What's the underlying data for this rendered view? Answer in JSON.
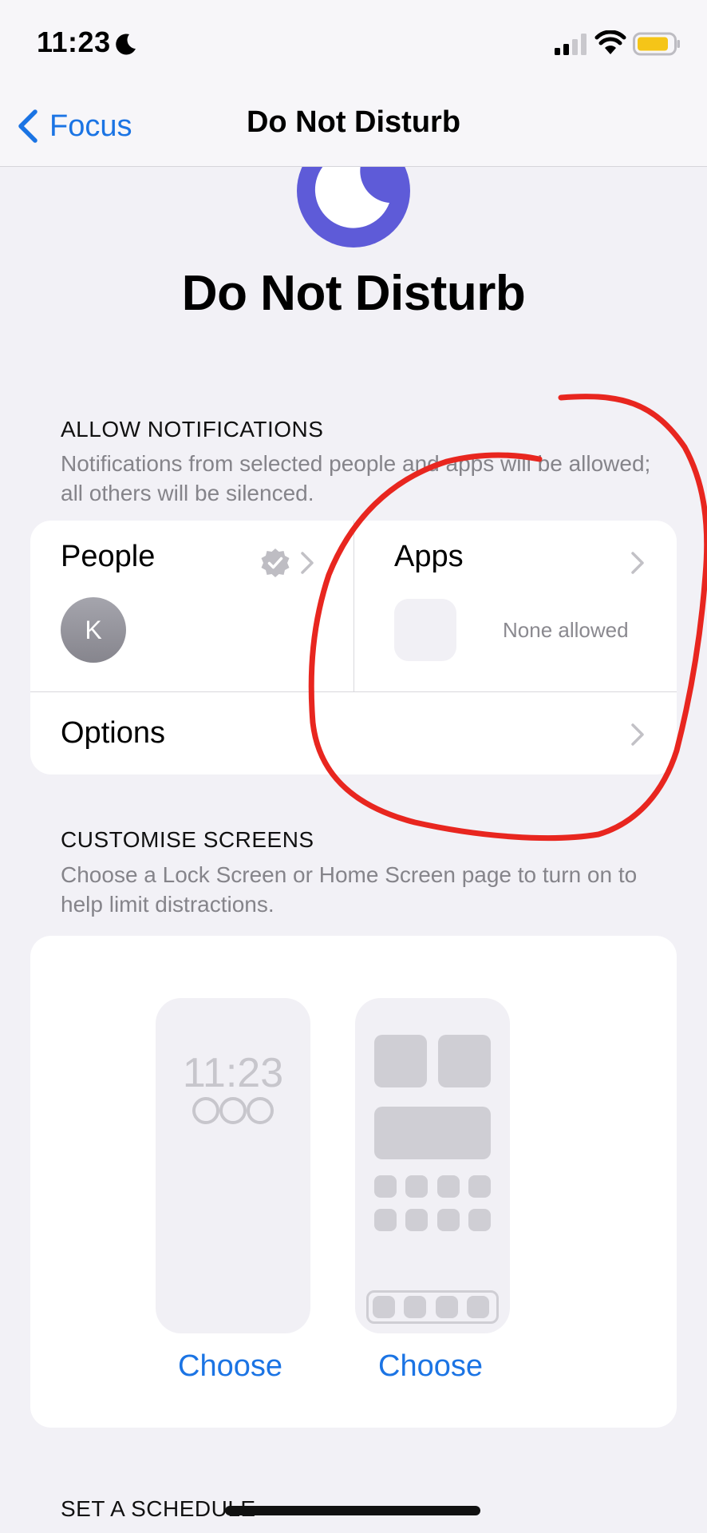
{
  "status_bar": {
    "time": "11:23"
  },
  "nav": {
    "back_label": "Focus",
    "title": "Do Not Disturb"
  },
  "hero": {
    "title": "Do Not Disturb",
    "icon": "moon-icon",
    "icon_color": "#5e5bd8"
  },
  "allow_notifications": {
    "header": "ALLOW NOTIFICATIONS",
    "description": "Notifications from selected people and apps will be allowed; all others will be silenced.",
    "people_label": "People",
    "people_avatar_initial": "K",
    "apps_label": "Apps",
    "apps_status": "None allowed",
    "options_label": "Options"
  },
  "customise_screens": {
    "header": "CUSTOMISE SCREENS",
    "description": "Choose a Lock Screen or Home Screen page to turn on to help limit distractions.",
    "lock_mock_time": "11:23",
    "lock_choose": "Choose",
    "home_choose": "Choose"
  },
  "schedule": {
    "header": "SET A SCHEDULE"
  },
  "colors": {
    "accent": "#1b74e4",
    "annotation": "#e8261f",
    "battery": "#f5c518"
  }
}
